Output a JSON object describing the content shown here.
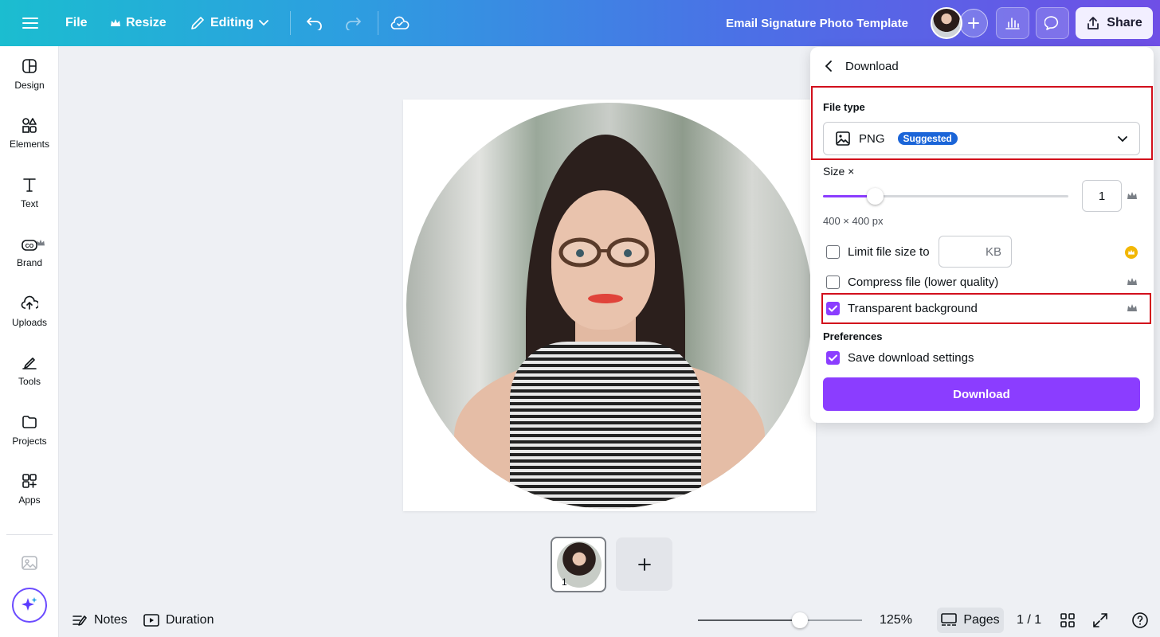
{
  "topbar": {
    "file_label": "File",
    "resize_label": "Resize",
    "editing_label": "Editing",
    "title": "Email Signature Photo Template",
    "share_label": "Share"
  },
  "sidebar": {
    "items": [
      {
        "label": "Design",
        "icon": "design-icon"
      },
      {
        "label": "Elements",
        "icon": "elements-icon"
      },
      {
        "label": "Text",
        "icon": "text-icon"
      },
      {
        "label": "Brand",
        "icon": "brand-icon"
      },
      {
        "label": "Uploads",
        "icon": "uploads-icon"
      },
      {
        "label": "Tools",
        "icon": "tools-icon"
      },
      {
        "label": "Projects",
        "icon": "projects-icon"
      },
      {
        "label": "Apps",
        "icon": "apps-icon"
      }
    ]
  },
  "pages": {
    "thumb_number": "1"
  },
  "bottombar": {
    "notes_label": "Notes",
    "duration_label": "Duration",
    "zoom": "125%",
    "zoom_level_fraction": 0.62,
    "pages_label": "Pages",
    "page_count": "1 / 1"
  },
  "download_panel": {
    "title": "Download",
    "file_type_label": "File type",
    "file_type_value": "PNG",
    "suggested_badge": "Suggested",
    "size_label": "Size ×",
    "size_value": "1",
    "size_slider_fraction": 0.21,
    "dimensions": "400 × 400 px",
    "limit_label": "Limit file size to",
    "limit_unit": "KB",
    "limit_checked": false,
    "compress_label": "Compress file (lower quality)",
    "compress_checked": false,
    "transparent_label": "Transparent background",
    "transparent_checked": true,
    "preferences_label": "Preferences",
    "save_settings_label": "Save download settings",
    "save_settings_checked": true,
    "download_button": "Download"
  },
  "colors": {
    "accent": "#8b3dff",
    "highlight": "#d20f1c",
    "badge": "#1b65d8"
  }
}
